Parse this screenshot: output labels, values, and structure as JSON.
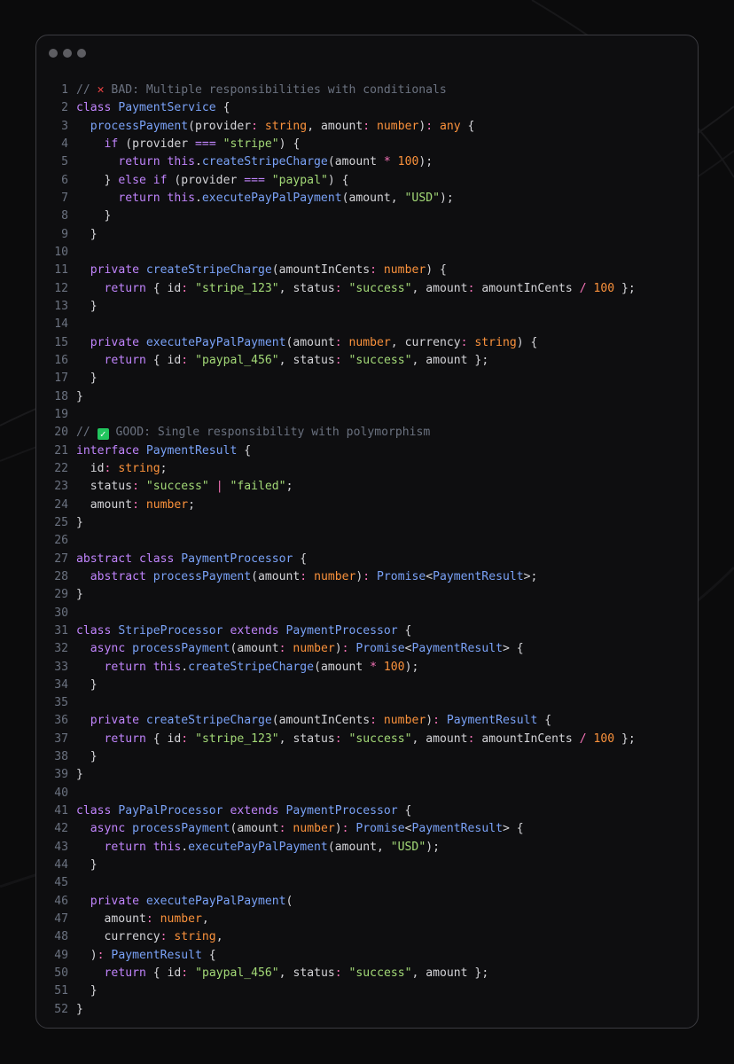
{
  "window": {
    "controls": [
      "dot",
      "dot",
      "dot"
    ]
  },
  "colors": {
    "background": "#0b0b0c",
    "panel": "#0e0e10",
    "keyword": "#c084fc",
    "type": "#fb923c",
    "function": "#7aa2f7",
    "string": "#a3d977",
    "comment": "#6b7280"
  },
  "code": {
    "lines": [
      [
        {
          "c": "c",
          "t": "// "
        },
        {
          "c": "emoji-x",
          "t": "✕"
        },
        {
          "c": "c",
          "t": " BAD: Multiple responsibilities with conditionals"
        }
      ],
      [
        {
          "c": "k",
          "t": "class "
        },
        {
          "c": "f",
          "t": "PaymentService"
        },
        {
          "c": "p",
          "t": " {"
        }
      ],
      [
        {
          "c": "p",
          "t": "  "
        },
        {
          "c": "f",
          "t": "processPayment"
        },
        {
          "c": "p",
          "t": "(provider"
        },
        {
          "c": "o",
          "t": ":"
        },
        {
          "c": "t",
          "t": " string"
        },
        {
          "c": "p",
          "t": ", amount"
        },
        {
          "c": "o",
          "t": ":"
        },
        {
          "c": "t",
          "t": " number"
        },
        {
          "c": "p",
          "t": ")"
        },
        {
          "c": "o",
          "t": ":"
        },
        {
          "c": "t",
          "t": " any"
        },
        {
          "c": "p",
          "t": " {"
        }
      ],
      [
        {
          "c": "p",
          "t": "    "
        },
        {
          "c": "k",
          "t": "if"
        },
        {
          "c": "p",
          "t": " (provider "
        },
        {
          "c": "k",
          "t": "==="
        },
        {
          "c": "p",
          "t": " "
        },
        {
          "c": "s",
          "t": "\"stripe\""
        },
        {
          "c": "p",
          "t": ") {"
        }
      ],
      [
        {
          "c": "p",
          "t": "      "
        },
        {
          "c": "k",
          "t": "return this"
        },
        {
          "c": "p",
          "t": "."
        },
        {
          "c": "f",
          "t": "createStripeCharge"
        },
        {
          "c": "p",
          "t": "(amount "
        },
        {
          "c": "o",
          "t": "*"
        },
        {
          "c": "n",
          "t": " 100"
        },
        {
          "c": "p",
          "t": ");"
        }
      ],
      [
        {
          "c": "p",
          "t": "    } "
        },
        {
          "c": "k",
          "t": "else if"
        },
        {
          "c": "p",
          "t": " (provider "
        },
        {
          "c": "k",
          "t": "==="
        },
        {
          "c": "p",
          "t": " "
        },
        {
          "c": "s",
          "t": "\"paypal\""
        },
        {
          "c": "p",
          "t": ") {"
        }
      ],
      [
        {
          "c": "p",
          "t": "      "
        },
        {
          "c": "k",
          "t": "return this"
        },
        {
          "c": "p",
          "t": "."
        },
        {
          "c": "f",
          "t": "executePayPalPayment"
        },
        {
          "c": "p",
          "t": "(amount, "
        },
        {
          "c": "s",
          "t": "\"USD\""
        },
        {
          "c": "p",
          "t": ");"
        }
      ],
      [
        {
          "c": "p",
          "t": "    }"
        }
      ],
      [
        {
          "c": "p",
          "t": "  }"
        }
      ],
      [],
      [
        {
          "c": "p",
          "t": "  "
        },
        {
          "c": "k",
          "t": "private "
        },
        {
          "c": "f",
          "t": "createStripeCharge"
        },
        {
          "c": "p",
          "t": "(amountInCents"
        },
        {
          "c": "o",
          "t": ":"
        },
        {
          "c": "t",
          "t": " number"
        },
        {
          "c": "p",
          "t": ") {"
        }
      ],
      [
        {
          "c": "p",
          "t": "    "
        },
        {
          "c": "k",
          "t": "return"
        },
        {
          "c": "p",
          "t": " { id"
        },
        {
          "c": "o",
          "t": ":"
        },
        {
          "c": "p",
          "t": " "
        },
        {
          "c": "s",
          "t": "\"stripe_123\""
        },
        {
          "c": "p",
          "t": ", status"
        },
        {
          "c": "o",
          "t": ":"
        },
        {
          "c": "p",
          "t": " "
        },
        {
          "c": "s",
          "t": "\"success\""
        },
        {
          "c": "p",
          "t": ", amount"
        },
        {
          "c": "o",
          "t": ":"
        },
        {
          "c": "p",
          "t": " amountInCents "
        },
        {
          "c": "o",
          "t": "/"
        },
        {
          "c": "n",
          "t": " 100"
        },
        {
          "c": "p",
          "t": " };"
        }
      ],
      [
        {
          "c": "p",
          "t": "  }"
        }
      ],
      [],
      [
        {
          "c": "p",
          "t": "  "
        },
        {
          "c": "k",
          "t": "private "
        },
        {
          "c": "f",
          "t": "executePayPalPayment"
        },
        {
          "c": "p",
          "t": "(amount"
        },
        {
          "c": "o",
          "t": ":"
        },
        {
          "c": "t",
          "t": " number"
        },
        {
          "c": "p",
          "t": ", currency"
        },
        {
          "c": "o",
          "t": ":"
        },
        {
          "c": "t",
          "t": " string"
        },
        {
          "c": "p",
          "t": ") {"
        }
      ],
      [
        {
          "c": "p",
          "t": "    "
        },
        {
          "c": "k",
          "t": "return"
        },
        {
          "c": "p",
          "t": " { id"
        },
        {
          "c": "o",
          "t": ":"
        },
        {
          "c": "p",
          "t": " "
        },
        {
          "c": "s",
          "t": "\"paypal_456\""
        },
        {
          "c": "p",
          "t": ", status"
        },
        {
          "c": "o",
          "t": ":"
        },
        {
          "c": "p",
          "t": " "
        },
        {
          "c": "s",
          "t": "\"success\""
        },
        {
          "c": "p",
          "t": ", amount };"
        }
      ],
      [
        {
          "c": "p",
          "t": "  }"
        }
      ],
      [
        {
          "c": "p",
          "t": "}"
        }
      ],
      [],
      [
        {
          "c": "c",
          "t": "// "
        },
        {
          "c": "emoji-ok",
          "t": "✓"
        },
        {
          "c": "c",
          "t": " GOOD: Single responsibility with polymorphism"
        }
      ],
      [
        {
          "c": "k",
          "t": "interface "
        },
        {
          "c": "f",
          "t": "PaymentResult"
        },
        {
          "c": "p",
          "t": " {"
        }
      ],
      [
        {
          "c": "p",
          "t": "  id"
        },
        {
          "c": "o",
          "t": ":"
        },
        {
          "c": "t",
          "t": " string"
        },
        {
          "c": "p",
          "t": ";"
        }
      ],
      [
        {
          "c": "p",
          "t": "  status"
        },
        {
          "c": "o",
          "t": ":"
        },
        {
          "c": "p",
          "t": " "
        },
        {
          "c": "s",
          "t": "\"success\""
        },
        {
          "c": "p",
          "t": " "
        },
        {
          "c": "o",
          "t": "|"
        },
        {
          "c": "p",
          "t": " "
        },
        {
          "c": "s",
          "t": "\"failed\""
        },
        {
          "c": "p",
          "t": ";"
        }
      ],
      [
        {
          "c": "p",
          "t": "  amount"
        },
        {
          "c": "o",
          "t": ":"
        },
        {
          "c": "t",
          "t": " number"
        },
        {
          "c": "p",
          "t": ";"
        }
      ],
      [
        {
          "c": "p",
          "t": "}"
        }
      ],
      [],
      [
        {
          "c": "k",
          "t": "abstract class "
        },
        {
          "c": "f",
          "t": "PaymentProcessor"
        },
        {
          "c": "p",
          "t": " {"
        }
      ],
      [
        {
          "c": "p",
          "t": "  "
        },
        {
          "c": "k",
          "t": "abstract "
        },
        {
          "c": "f",
          "t": "processPayment"
        },
        {
          "c": "p",
          "t": "(amount"
        },
        {
          "c": "o",
          "t": ":"
        },
        {
          "c": "t",
          "t": " number"
        },
        {
          "c": "p",
          "t": ")"
        },
        {
          "c": "o",
          "t": ":"
        },
        {
          "c": "f",
          "t": " Promise"
        },
        {
          "c": "p",
          "t": "<"
        },
        {
          "c": "f",
          "t": "PaymentResult"
        },
        {
          "c": "p",
          "t": ">;"
        }
      ],
      [
        {
          "c": "p",
          "t": "}"
        }
      ],
      [],
      [
        {
          "c": "k",
          "t": "class "
        },
        {
          "c": "f",
          "t": "StripeProcessor"
        },
        {
          "c": "k",
          "t": " extends "
        },
        {
          "c": "f",
          "t": "PaymentProcessor"
        },
        {
          "c": "p",
          "t": " {"
        }
      ],
      [
        {
          "c": "p",
          "t": "  "
        },
        {
          "c": "k",
          "t": "async "
        },
        {
          "c": "f",
          "t": "processPayment"
        },
        {
          "c": "p",
          "t": "(amount"
        },
        {
          "c": "o",
          "t": ":"
        },
        {
          "c": "t",
          "t": " number"
        },
        {
          "c": "p",
          "t": ")"
        },
        {
          "c": "o",
          "t": ":"
        },
        {
          "c": "f",
          "t": " Promise"
        },
        {
          "c": "p",
          "t": "<"
        },
        {
          "c": "f",
          "t": "PaymentResult"
        },
        {
          "c": "p",
          "t": "> {"
        }
      ],
      [
        {
          "c": "p",
          "t": "    "
        },
        {
          "c": "k",
          "t": "return this"
        },
        {
          "c": "p",
          "t": "."
        },
        {
          "c": "f",
          "t": "createStripeCharge"
        },
        {
          "c": "p",
          "t": "(amount "
        },
        {
          "c": "o",
          "t": "*"
        },
        {
          "c": "n",
          "t": " 100"
        },
        {
          "c": "p",
          "t": ");"
        }
      ],
      [
        {
          "c": "p",
          "t": "  }"
        }
      ],
      [],
      [
        {
          "c": "p",
          "t": "  "
        },
        {
          "c": "k",
          "t": "private "
        },
        {
          "c": "f",
          "t": "createStripeCharge"
        },
        {
          "c": "p",
          "t": "(amountInCents"
        },
        {
          "c": "o",
          "t": ":"
        },
        {
          "c": "t",
          "t": " number"
        },
        {
          "c": "p",
          "t": ")"
        },
        {
          "c": "o",
          "t": ":"
        },
        {
          "c": "f",
          "t": " PaymentResult"
        },
        {
          "c": "p",
          "t": " {"
        }
      ],
      [
        {
          "c": "p",
          "t": "    "
        },
        {
          "c": "k",
          "t": "return"
        },
        {
          "c": "p",
          "t": " { id"
        },
        {
          "c": "o",
          "t": ":"
        },
        {
          "c": "p",
          "t": " "
        },
        {
          "c": "s",
          "t": "\"stripe_123\""
        },
        {
          "c": "p",
          "t": ", status"
        },
        {
          "c": "o",
          "t": ":"
        },
        {
          "c": "p",
          "t": " "
        },
        {
          "c": "s",
          "t": "\"success\""
        },
        {
          "c": "p",
          "t": ", amount"
        },
        {
          "c": "o",
          "t": ":"
        },
        {
          "c": "p",
          "t": " amountInCents "
        },
        {
          "c": "o",
          "t": "/"
        },
        {
          "c": "n",
          "t": " 100"
        },
        {
          "c": "p",
          "t": " };"
        }
      ],
      [
        {
          "c": "p",
          "t": "  }"
        }
      ],
      [
        {
          "c": "p",
          "t": "}"
        }
      ],
      [],
      [
        {
          "c": "k",
          "t": "class "
        },
        {
          "c": "f",
          "t": "PayPalProcessor"
        },
        {
          "c": "k",
          "t": " extends "
        },
        {
          "c": "f",
          "t": "PaymentProcessor"
        },
        {
          "c": "p",
          "t": " {"
        }
      ],
      [
        {
          "c": "p",
          "t": "  "
        },
        {
          "c": "k",
          "t": "async "
        },
        {
          "c": "f",
          "t": "processPayment"
        },
        {
          "c": "p",
          "t": "(amount"
        },
        {
          "c": "o",
          "t": ":"
        },
        {
          "c": "t",
          "t": " number"
        },
        {
          "c": "p",
          "t": ")"
        },
        {
          "c": "o",
          "t": ":"
        },
        {
          "c": "f",
          "t": " Promise"
        },
        {
          "c": "p",
          "t": "<"
        },
        {
          "c": "f",
          "t": "PaymentResult"
        },
        {
          "c": "p",
          "t": "> {"
        }
      ],
      [
        {
          "c": "p",
          "t": "    "
        },
        {
          "c": "k",
          "t": "return this"
        },
        {
          "c": "p",
          "t": "."
        },
        {
          "c": "f",
          "t": "executePayPalPayment"
        },
        {
          "c": "p",
          "t": "(amount, "
        },
        {
          "c": "s",
          "t": "\"USD\""
        },
        {
          "c": "p",
          "t": ");"
        }
      ],
      [
        {
          "c": "p",
          "t": "  }"
        }
      ],
      [],
      [
        {
          "c": "p",
          "t": "  "
        },
        {
          "c": "k",
          "t": "private "
        },
        {
          "c": "f",
          "t": "executePayPalPayment"
        },
        {
          "c": "p",
          "t": "("
        }
      ],
      [
        {
          "c": "p",
          "t": "    amount"
        },
        {
          "c": "o",
          "t": ":"
        },
        {
          "c": "t",
          "t": " number"
        },
        {
          "c": "p",
          "t": ","
        }
      ],
      [
        {
          "c": "p",
          "t": "    currency"
        },
        {
          "c": "o",
          "t": ":"
        },
        {
          "c": "t",
          "t": " string"
        },
        {
          "c": "p",
          "t": ","
        }
      ],
      [
        {
          "c": "p",
          "t": "  )"
        },
        {
          "c": "o",
          "t": ":"
        },
        {
          "c": "f",
          "t": " PaymentResult"
        },
        {
          "c": "p",
          "t": " {"
        }
      ],
      [
        {
          "c": "p",
          "t": "    "
        },
        {
          "c": "k",
          "t": "return"
        },
        {
          "c": "p",
          "t": " { id"
        },
        {
          "c": "o",
          "t": ":"
        },
        {
          "c": "p",
          "t": " "
        },
        {
          "c": "s",
          "t": "\"paypal_456\""
        },
        {
          "c": "p",
          "t": ", status"
        },
        {
          "c": "o",
          "t": ":"
        },
        {
          "c": "p",
          "t": " "
        },
        {
          "c": "s",
          "t": "\"success\""
        },
        {
          "c": "p",
          "t": ", amount };"
        }
      ],
      [
        {
          "c": "p",
          "t": "  }"
        }
      ],
      [
        {
          "c": "p",
          "t": "}"
        }
      ]
    ]
  }
}
